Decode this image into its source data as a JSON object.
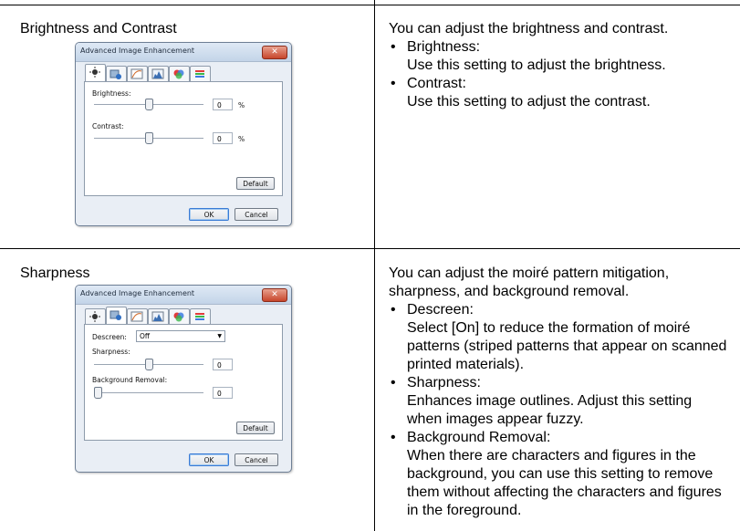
{
  "rows": [
    {
      "title": "Brightness and Contrast",
      "dialog": {
        "title": "Advanced Image Enhancement",
        "close_glyph": "✕",
        "brightness_label": "Brightness:",
        "brightness_value": "0",
        "brightness_unit": "%",
        "brightness_level": 0.5,
        "contrast_label": "Contrast:",
        "contrast_value": "0",
        "contrast_unit": "%",
        "contrast_level": 0.5,
        "default_label": "Default",
        "ok_label": "OK",
        "cancel_label": "Cancel",
        "active_tab": 0
      },
      "description": {
        "intro": "You can adjust the brightness and contrast.",
        "items": [
          {
            "heading": "Brightness:",
            "text": "Use this setting to adjust the brightness."
          },
          {
            "heading": "Contrast:",
            "text": "Use this setting to adjust the contrast."
          }
        ]
      }
    },
    {
      "title": "Sharpness",
      "dialog": {
        "title": "Advanced Image Enhancement",
        "close_glyph": "✕",
        "descreen_label": "Descreen:",
        "descreen_value": "Off",
        "sharpness_label": "Sharpness:",
        "sharpness_value": "0",
        "sharpness_level": 0.5,
        "background_label": "Background Removal:",
        "background_value": "0",
        "background_level": 0.0,
        "default_label": "Default",
        "ok_label": "OK",
        "cancel_label": "Cancel",
        "active_tab": 1
      },
      "description": {
        "intro": "You can adjust the moiré pattern mitigation, sharpness, and background removal.",
        "items": [
          {
            "heading": "Descreen:",
            "text": "Select [On] to reduce the formation of moiré patterns (striped patterns that appear on scanned printed materials)."
          },
          {
            "heading": "Sharpness:",
            "text": "Enhances image outlines. Adjust this setting when images appear fuzzy."
          },
          {
            "heading": "Background Removal:",
            "text": "When there are characters and figures in the background, you can use this setting to remove them without affecting the characters and figures in the foreground."
          }
        ]
      }
    }
  ],
  "bullet": "•",
  "tab_icons": [
    "brightness-icon",
    "sharpness-icon",
    "curve-icon",
    "histogram-icon",
    "color-balance-icon",
    "hue-icon"
  ],
  "colors": {
    "close_button": "#c7452b",
    "focus": "#3a7bd5"
  }
}
